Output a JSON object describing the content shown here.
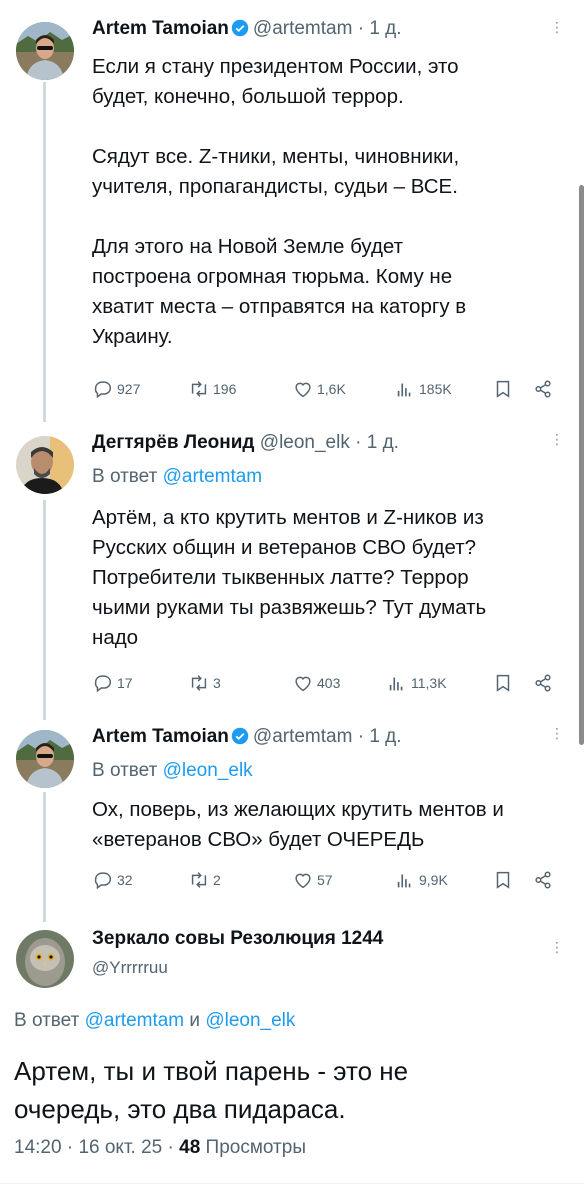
{
  "tweets": [
    {
      "name": "Artem Tamoian",
      "handle": "@artemtam",
      "time": "1 д.",
      "text": "Если я стану президентом России, это\nбудет, конечно, большой террор.\n\nСядут все. Z-тники, менты, чиновники,\nучителя, пропагандисты, судьи – ВСЕ.\n\nДля этого на Новой Земле будет\nпостроена огромная тюрьма. Кому не\nхватит места – отправятся на каторгу в\nУкраину.",
      "replies": "927",
      "retweets": "196",
      "likes": "1,6K",
      "views": "185K"
    },
    {
      "name": "Дегтярёв Леонид",
      "handle": "@leon_elk",
      "time": "1 д.",
      "reply_prefix": "В ответ",
      "reply_to": "@artemtam",
      "text": "Артём, а кто крутить ментов и Z-ников из\nРусских общин и ветеранов СВО будет?\nПотребители тыквенных латте? Террор\nчьими руками ты развяжешь? Тут думать\nнадо",
      "replies": "17",
      "retweets": "3",
      "likes": "403",
      "views": "11,3K"
    },
    {
      "name": "Artem Tamoian",
      "handle": "@artemtam",
      "time": "1 д.",
      "reply_prefix": "В ответ",
      "reply_to": "@leon_elk",
      "text": "Ох, поверь, из желающих крутить ментов и\n«ветеранов СВО» будет ОЧЕРЕДЬ",
      "replies": "32",
      "retweets": "2",
      "likes": "57",
      "views": "9,9K"
    }
  ],
  "main": {
    "name": "Зеркало совы Резолюция 1244",
    "handle": "@Yrrrrruu",
    "reply_prefix": "В ответ",
    "reply_to_1": "@artemtam",
    "reply_and": "и",
    "reply_to_2": "@leon_elk",
    "text": "Артем, ты и твой парень - это не\nочередь, это два пидараса.",
    "time": "14:20",
    "date": "16 окт. 25",
    "views_count": "48",
    "views_label": "Просмотры"
  },
  "colors": {
    "accent": "#1d9bf0",
    "secondary_text": "#536471",
    "primary_text": "#0f1419"
  },
  "icons": [
    "reply-icon",
    "retweet-icon",
    "like-icon",
    "views-icon",
    "bookmark-icon",
    "share-icon",
    "verified-icon",
    "more-icon"
  ]
}
